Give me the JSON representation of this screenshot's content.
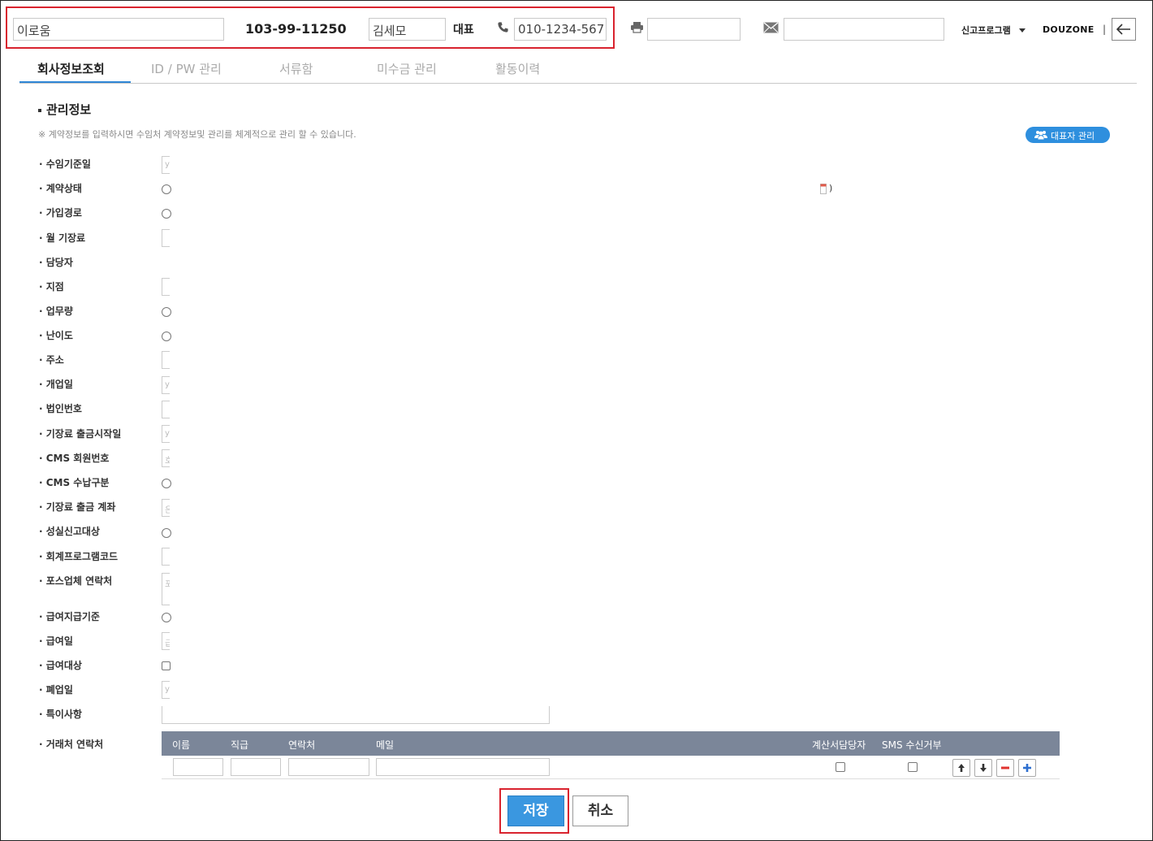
{
  "header": {
    "company_name": "이로움",
    "business_number": "103-99-11250",
    "representative_name": "김세모",
    "representative_label": "대표",
    "phone": "010-1234-567",
    "fax": "",
    "email": "",
    "menu_label": "신고프로그램",
    "brand": "DOUZONE",
    "divider": "|"
  },
  "tabs": [
    {
      "label": "회사정보조회",
      "active": true
    },
    {
      "label": "ID / PW 관리",
      "active": false
    },
    {
      "label": "서류함",
      "active": false
    },
    {
      "label": "미수금 관리",
      "active": false
    },
    {
      "label": "활동이력",
      "active": false
    }
  ],
  "section": {
    "title": "관리정보",
    "note": "※ 계약정보를 입력하시면 수임처 계약정보및 관리를 체계적으로 관리 할 수 있습니다.",
    "rep_button": "대표자 관리",
    "contract_close": ")"
  },
  "fields": [
    {
      "label": "· 수임기준일",
      "type": "text",
      "placeholder": "y"
    },
    {
      "label": "· 계약상태",
      "type": "radio"
    },
    {
      "label": "· 가입경로",
      "type": "radio"
    },
    {
      "label": "· 월 기장료",
      "type": "text",
      "placeholder": ""
    },
    {
      "label": "· 담당자",
      "type": "none"
    },
    {
      "label": "· 지점",
      "type": "text",
      "placeholder": ""
    },
    {
      "label": "· 업무량",
      "type": "radio"
    },
    {
      "label": "· 난이도",
      "type": "radio"
    },
    {
      "label": "· 주소",
      "type": "text",
      "placeholder": ""
    },
    {
      "label": "· 개업일",
      "type": "text",
      "placeholder": "y"
    },
    {
      "label": "· 법인번호",
      "type": "text",
      "placeholder": ""
    },
    {
      "label": "· 기장료 출금시작일",
      "type": "text",
      "placeholder": "y"
    },
    {
      "label": "· CMS 회원번호",
      "type": "text",
      "placeholder": "호"
    },
    {
      "label": "· CMS 수납구분",
      "type": "radio"
    },
    {
      "label": "· 기장료 출금 계좌",
      "type": "text",
      "placeholder": "은"
    },
    {
      "label": "· 성실신고대상",
      "type": "radio"
    },
    {
      "label": "· 회계프로그램코드",
      "type": "text",
      "placeholder": ""
    },
    {
      "label": "· 포스업체 연락처",
      "type": "text",
      "placeholder": "포"
    },
    {
      "label": "· 급여지급기준",
      "type": "radio"
    },
    {
      "label": "· 급여일",
      "type": "text",
      "placeholder": "급"
    },
    {
      "label": "· 급여대상",
      "type": "check"
    },
    {
      "label": "· 폐업일",
      "type": "text",
      "placeholder": "y"
    },
    {
      "label": "· 특이사항",
      "type": "textarea"
    }
  ],
  "contacts": {
    "label": "· 거래처 연락처",
    "columns": [
      "이름",
      "직급",
      "연락처",
      "메일",
      "계산서담당자",
      "SMS 수신거부"
    ]
  },
  "actions": {
    "save": "저장",
    "cancel": "취소"
  },
  "colors": {
    "accent": "#2e86d6",
    "highlight": "#d9232e",
    "table_header": "#7b8699"
  }
}
